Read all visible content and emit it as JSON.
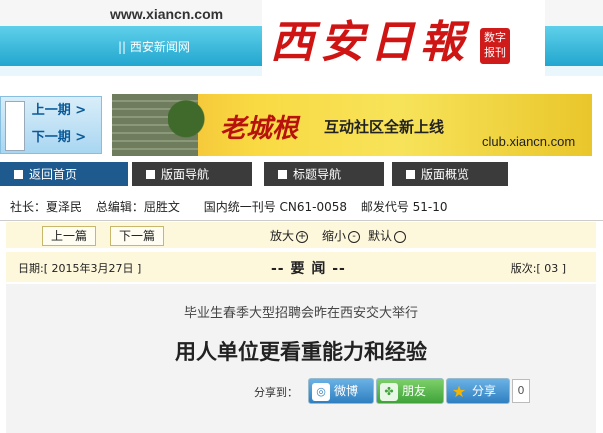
{
  "header": {
    "site_url": "www.xiancn.com",
    "site_name": "|| 西安新闻网",
    "logo_text": "西安日報",
    "logo_tag_line1": "数字",
    "logo_tag_line2": "报刊"
  },
  "issue_nav": {
    "prev_label": "上一期 >",
    "next_label": "下一期 >"
  },
  "banner": {
    "big_text": "老城根",
    "text": "互动社区全新上线",
    "url": "club.xiancn.com"
  },
  "nav": {
    "tabs": [
      {
        "label": "返回首页"
      },
      {
        "label": "版面导航"
      },
      {
        "label": "标题导航"
      },
      {
        "label": "版面概览"
      }
    ]
  },
  "info": {
    "president": "社长：夏泽民",
    "editor": "总编辑：屈胜文",
    "issn": "国内统一刊号 CN61-0058",
    "postal": "邮发代号 51-10"
  },
  "tools": {
    "prev_article": "上一篇",
    "next_article": "下一篇",
    "zoom_in": "放大",
    "zoom_in_icon": "+",
    "zoom_out": "缩小",
    "zoom_out_icon": "-",
    "reset": "默认"
  },
  "datebar": {
    "date": "日期:[ 2015年3月27日 ]",
    "section": "-- 要 闻 --",
    "edition": "版次:[ 03 ]"
  },
  "article": {
    "subtitle": "毕业生春季大型招聘会昨在西安交大举行",
    "headline": "用人单位更看重能力和经验",
    "share_label": "分享到：",
    "share": {
      "weibo": "微博",
      "pengyou": "朋友",
      "fenxiang": "分享",
      "count": "0"
    }
  }
}
